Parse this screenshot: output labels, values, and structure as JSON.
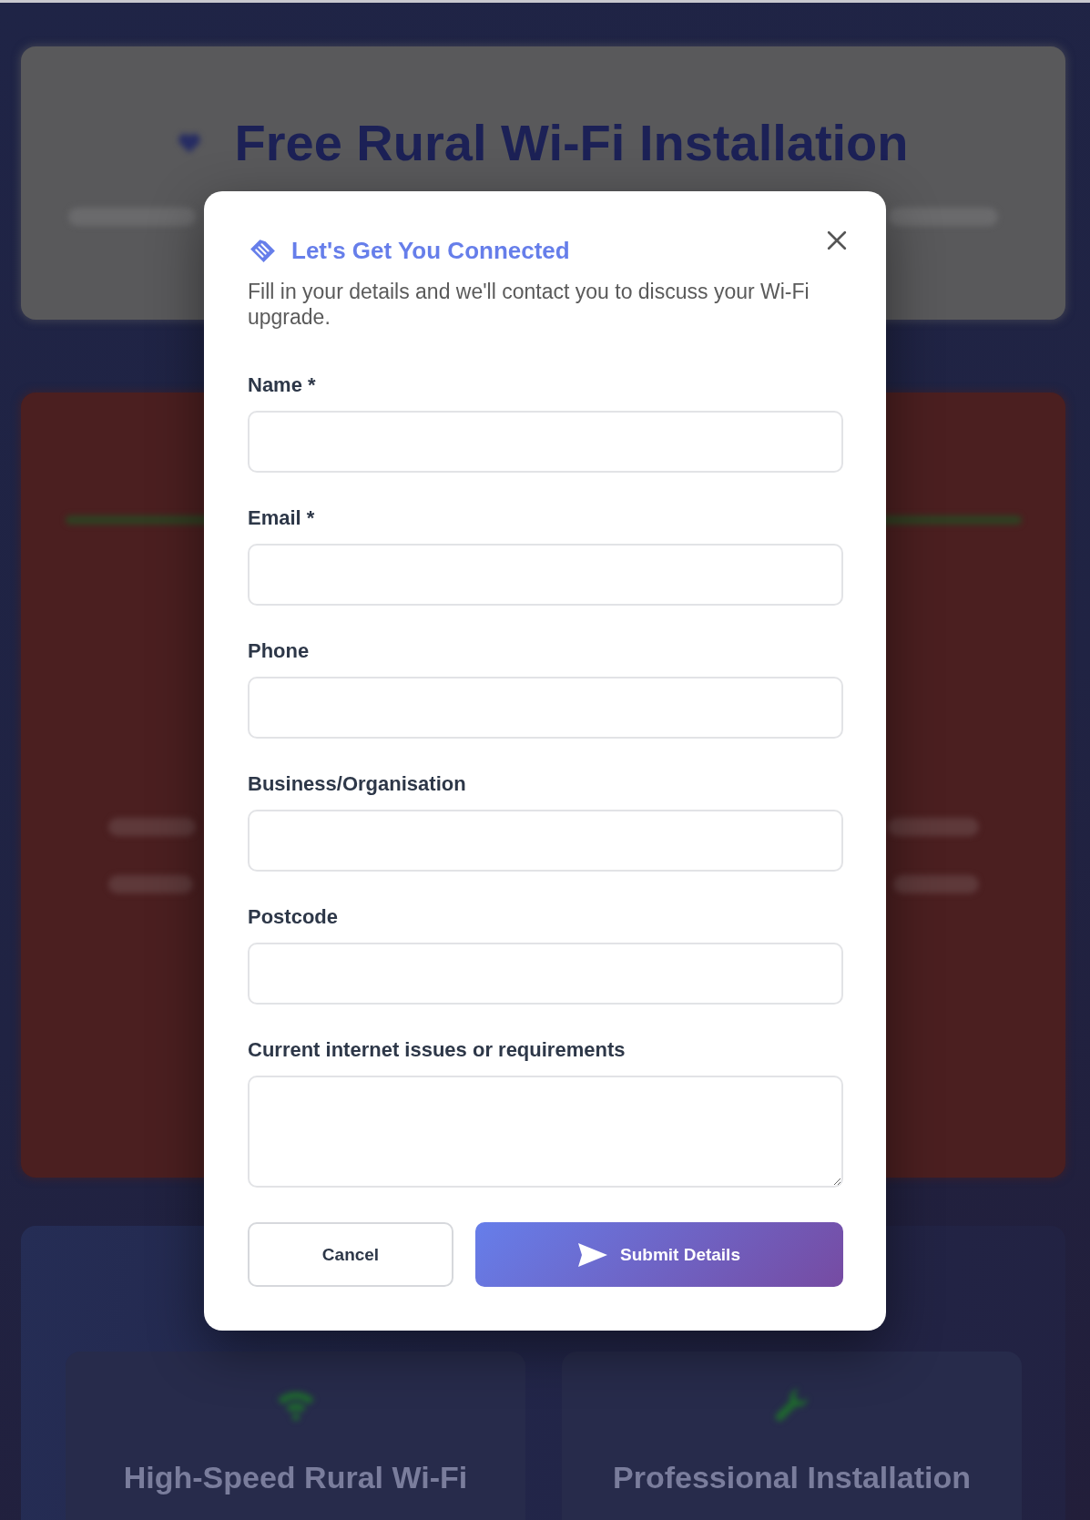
{
  "background": {
    "hero": {
      "title": "Free Rural Wi-Fi Installation"
    },
    "features": [
      {
        "title": "High-Speed Rural Wi-Fi"
      },
      {
        "title": "Professional Installation"
      }
    ]
  },
  "modal": {
    "title": "Let's Get You Connected",
    "description": "Fill in your details and we'll contact you to discuss your Wi-Fi upgrade.",
    "fields": [
      {
        "kind": "input",
        "label": "Name *"
      },
      {
        "kind": "input",
        "label": "Email *"
      },
      {
        "kind": "input",
        "label": "Phone"
      },
      {
        "kind": "input",
        "label": "Business/Organisation"
      },
      {
        "kind": "input",
        "label": "Postcode"
      },
      {
        "kind": "textarea",
        "label": "Current internet issues or requirements"
      }
    ],
    "buttons": [
      {
        "kind": "secondary",
        "label": "Cancel"
      },
      {
        "kind": "primary",
        "label": "Submit Details"
      }
    ]
  }
}
